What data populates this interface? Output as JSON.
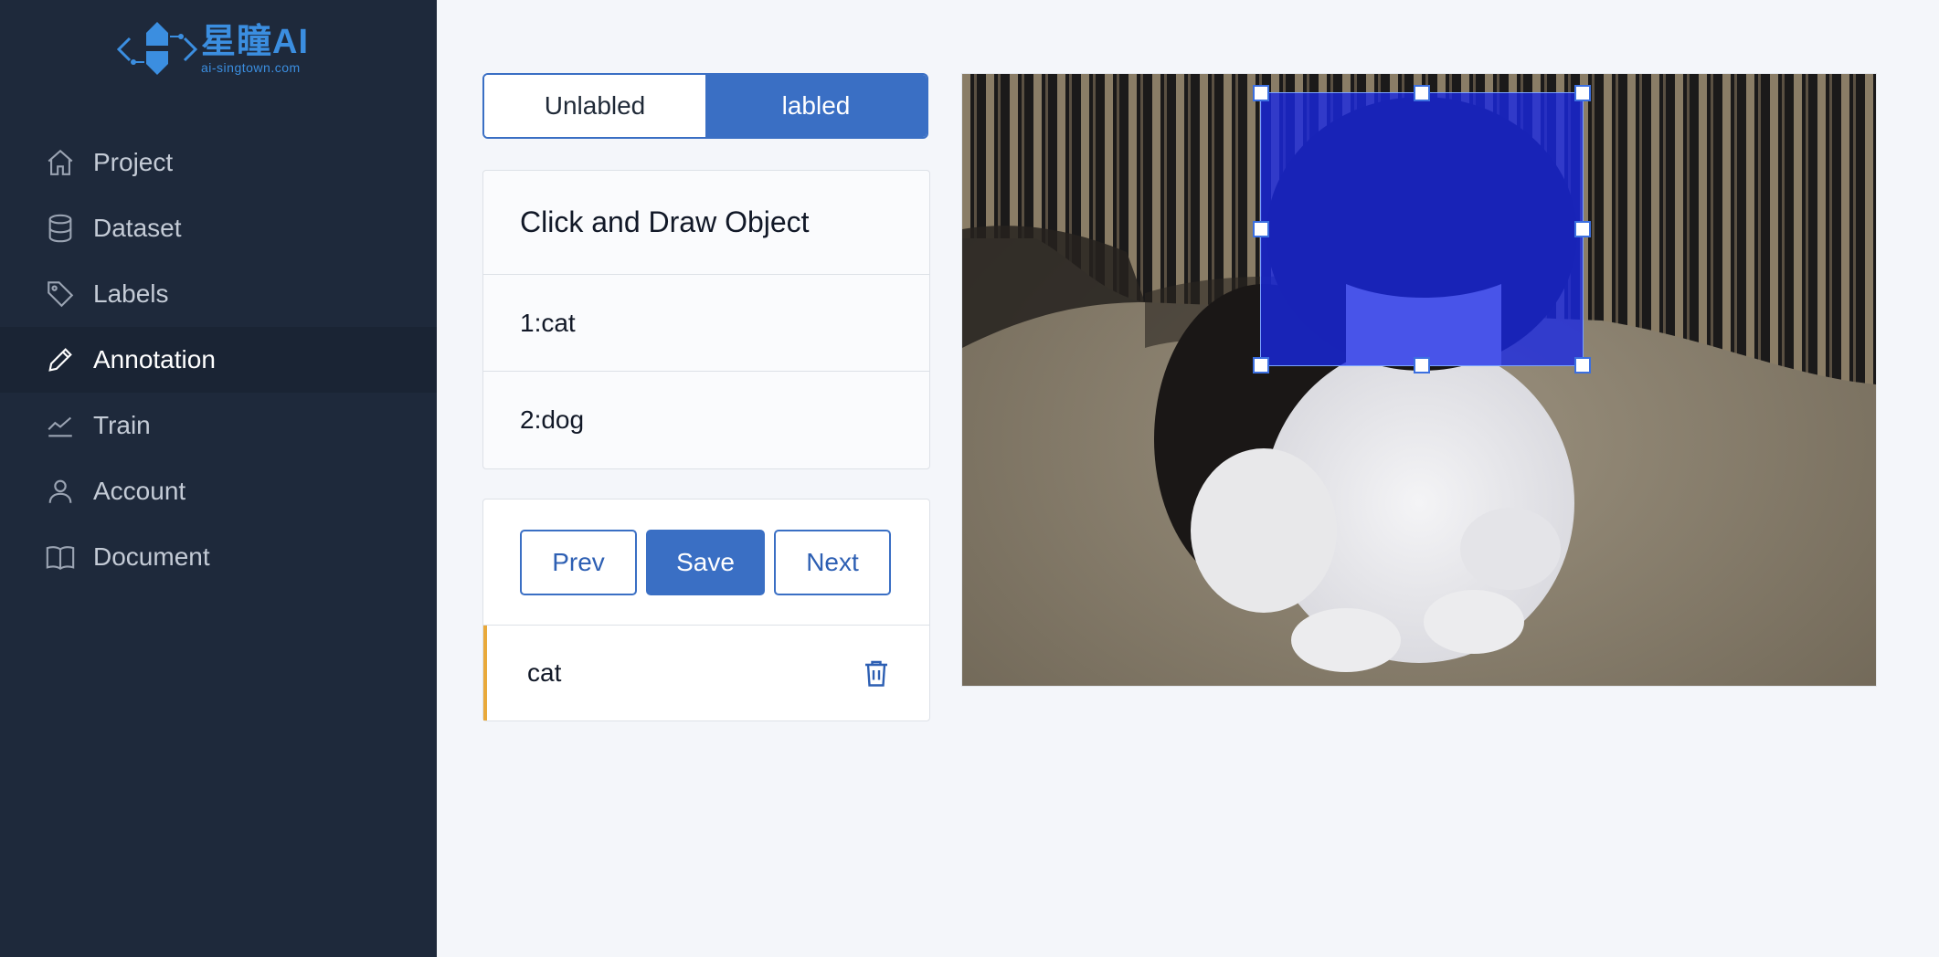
{
  "logo": {
    "brand": "星瞳AI",
    "url": "ai-singtown.com",
    "accent": "#3b8ee0"
  },
  "sidebar": {
    "items": [
      {
        "label": "Project",
        "icon": "home-icon"
      },
      {
        "label": "Dataset",
        "icon": "database-icon"
      },
      {
        "label": "Labels",
        "icon": "tag-icon"
      },
      {
        "label": "Annotation",
        "icon": "pencil-icon",
        "active": true
      },
      {
        "label": "Train",
        "icon": "chart-line-icon"
      },
      {
        "label": "Account",
        "icon": "user-icon"
      },
      {
        "label": "Document",
        "icon": "book-icon"
      }
    ]
  },
  "filter_tabs": {
    "unlabeled": "Unlabled",
    "labeled": "labled",
    "selected": "labled"
  },
  "labels_panel": {
    "title": "Click and Draw Object",
    "items": [
      "1:cat",
      "2:dog"
    ]
  },
  "actions": {
    "prev": "Prev",
    "save": "Save",
    "next": "Next"
  },
  "annotations": [
    {
      "label": "cat",
      "accent": "#e9a93a"
    }
  ],
  "canvas": {
    "image_subject": "kitten on carpet",
    "box_color": "#1828e6"
  },
  "colors": {
    "sidebar_bg": "#1e293b",
    "primary": "#3a6fc4",
    "page_bg": "#f4f6fa"
  }
}
